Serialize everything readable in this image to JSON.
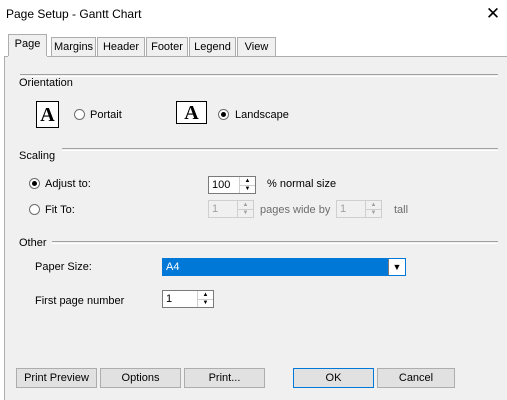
{
  "window": {
    "title": "Page Setup - Gantt Chart",
    "close_glyph": "✕"
  },
  "tabs": [
    {
      "label": "Page",
      "active": true
    },
    {
      "label": "Margins",
      "active": false
    },
    {
      "label": "Header",
      "active": false
    },
    {
      "label": "Footer",
      "active": false
    },
    {
      "label": "Legend",
      "active": false
    },
    {
      "label": "View",
      "active": false
    }
  ],
  "orientation": {
    "group_label": "Orientation",
    "icon_letter": "A",
    "portrait_label": "Portait",
    "landscape_label": "Landscape",
    "selected": "landscape"
  },
  "scaling": {
    "group_label": "Scaling",
    "adjust_label": "Adjust to:",
    "adjust_value": "100",
    "adjust_suffix": "% normal size",
    "fit_label": "Fit To:",
    "fit_wide_value": "1",
    "fit_wide_suffix": "pages wide by",
    "fit_tall_value": "1",
    "fit_tall_suffix": "tall",
    "selected": "adjust"
  },
  "other": {
    "group_label": "Other",
    "paper_size_label": "Paper Size:",
    "paper_size_value": "A4",
    "first_page_label": "First page number",
    "first_page_value": "1"
  },
  "buttons": {
    "print_preview": "Print Preview",
    "options": "Options",
    "print": "Print...",
    "ok": "OK",
    "cancel": "Cancel"
  },
  "icons": {
    "spin_up": "▲",
    "spin_down": "▼",
    "dropdown": "▼"
  },
  "colors": {
    "selection": "#0078d7",
    "dialog_bg": "#f0f0f0"
  }
}
